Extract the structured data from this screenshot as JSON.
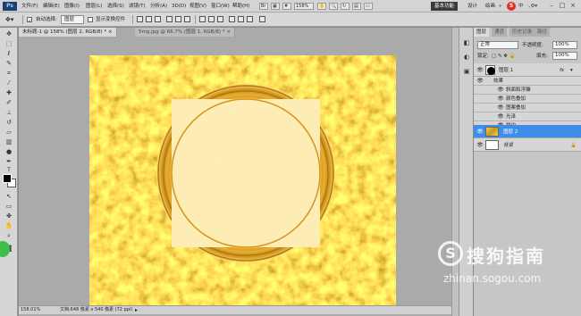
{
  "menubar": {
    "logo": "Ps",
    "items": [
      "文件(F)",
      "编辑(E)",
      "图像(I)",
      "图层(L)",
      "选择(S)",
      "滤镜(T)",
      "分析(A)",
      "3D(D)",
      "视图(V)",
      "窗口(W)",
      "帮助(H)"
    ],
    "zoom": "158%",
    "workspace_active": "基本功能",
    "workspace_links": [
      "设计",
      "绘画"
    ],
    "more": "»",
    "sogou_label": "中",
    "window_buttons": [
      "–",
      "□",
      "×"
    ]
  },
  "options": {
    "auto_select_label": "自动选择:",
    "auto_select_value": "图层",
    "transform_label": "显示变换控件"
  },
  "tabs": [
    {
      "label": "未标题-1 @ 158% (图层 2, RGB/8) *",
      "close": "×"
    },
    {
      "label": "5mg.jpg @ 66.7% (图层 1, RGB/8) *",
      "close": "×"
    }
  ],
  "status": {
    "zoom": "158.01%",
    "doc": "文档:648 像素 x 540 像素 (72 ppi)"
  },
  "panel": {
    "tabs": [
      "图层",
      "通道",
      "历史记录",
      "路径"
    ],
    "blend_mode": "正常",
    "opacity_label": "不透明度:",
    "opacity_value": "100%",
    "lock_label": "锁定:",
    "fill_label": "填充:",
    "fill_value": "100%",
    "layers": [
      {
        "name": "图层 1",
        "fx": "fx"
      },
      {
        "name": "效果"
      },
      {
        "name": "斜面和浮雕"
      },
      {
        "name": "颜色叠加"
      },
      {
        "name": "图案叠加"
      },
      {
        "name": "光泽"
      },
      {
        "name": "描边"
      },
      {
        "name": "图层 2"
      },
      {
        "name": "背景"
      }
    ]
  },
  "watermark": {
    "logo": "S",
    "title": "搜狗指南",
    "url": "zhinan.sogou.com"
  },
  "colors": {
    "gold_dark": "#c8961a",
    "gold_light": "#f5d84a",
    "disk": "#fbd77a",
    "selection": "#3d8ee8"
  }
}
